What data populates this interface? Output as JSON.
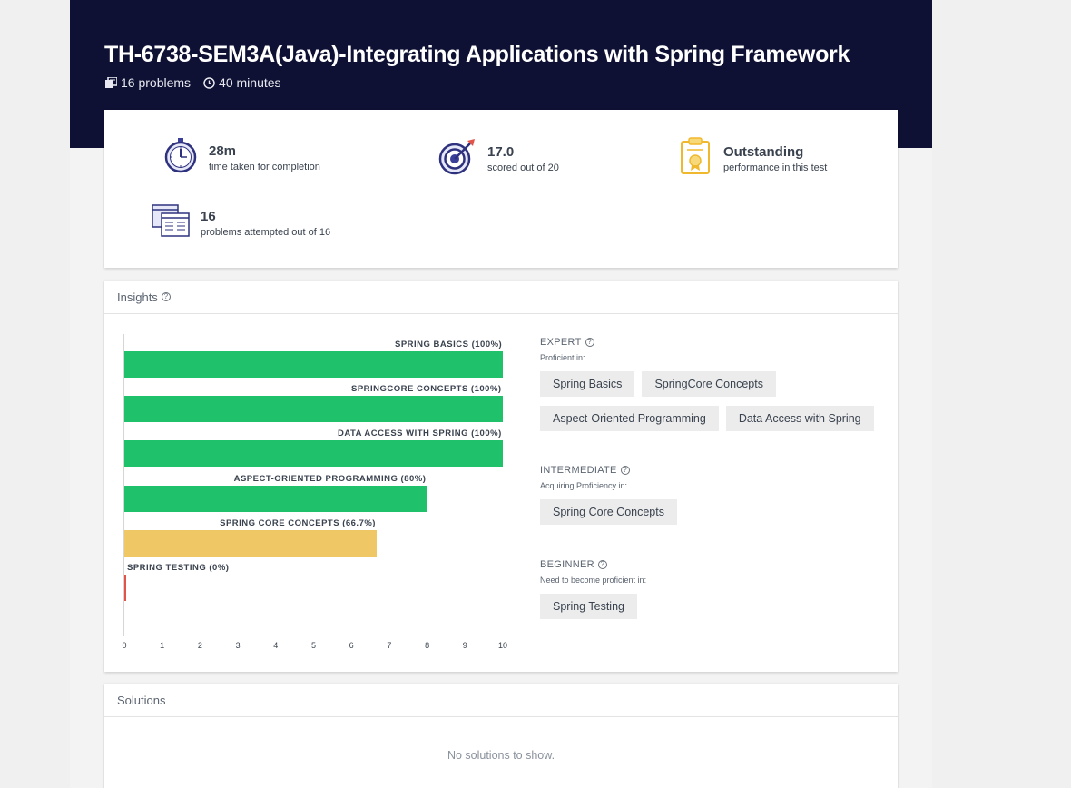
{
  "header": {
    "title": "TH-6738-SEM3A(Java)-Integrating Applications with Spring Framework",
    "problems": "16 problems",
    "duration": "40 minutes"
  },
  "summary": {
    "time": {
      "value": "28m",
      "label": "time taken for completion",
      "icon": "stopwatch-icon"
    },
    "score": {
      "value": "17.0",
      "label": "scored out of 20",
      "icon": "target-icon"
    },
    "performance": {
      "value": "Outstanding",
      "label": "performance in this test",
      "icon": "certificate-icon"
    },
    "attempted": {
      "value": "16",
      "label": "problems attempted out of 16",
      "icon": "documents-icon"
    }
  },
  "insights": {
    "heading": "Insights",
    "levels": {
      "expert": {
        "title": "EXPERT",
        "subtitle": "Proficient in:",
        "skills": [
          "Spring Basics",
          "SpringCore Concepts",
          "Aspect-Oriented Programming",
          "Data Access with Spring"
        ]
      },
      "intermediate": {
        "title": "INTERMEDIATE",
        "subtitle": "Acquiring Proficiency in:",
        "skills": [
          "Spring Core Concepts"
        ]
      },
      "beginner": {
        "title": "BEGINNER",
        "subtitle": "Need to become proficient in:",
        "skills": [
          "Spring Testing"
        ]
      }
    }
  },
  "chart_data": {
    "type": "bar",
    "orientation": "horizontal",
    "categories": [
      "SPRING BASICS (100%)",
      "SPRINGCORE CONCEPTS (100%)",
      "DATA ACCESS WITH SPRING (100%)",
      "ASPECT-ORIENTED PROGRAMMING (80%)",
      "SPRING CORE CONCEPTS (66.7%)",
      "SPRING TESTING (0%)"
    ],
    "values": [
      10,
      10,
      10,
      8,
      6.67,
      0
    ],
    "colors": [
      "#1fc16b",
      "#1fc16b",
      "#1fc16b",
      "#1fc16b",
      "#efc765",
      "#e2534a"
    ],
    "xticks": [
      "0",
      "1",
      "2",
      "3",
      "4",
      "5",
      "6",
      "7",
      "8",
      "9",
      "10"
    ],
    "xlim": [
      0,
      10
    ]
  },
  "solutions": {
    "heading": "Solutions",
    "empty": "No solutions to show."
  },
  "colors": {
    "hero": "#0e1133",
    "green": "#1fc16b",
    "yellow": "#efc765",
    "red": "#e2534a",
    "accent": "#3a3f9a"
  }
}
